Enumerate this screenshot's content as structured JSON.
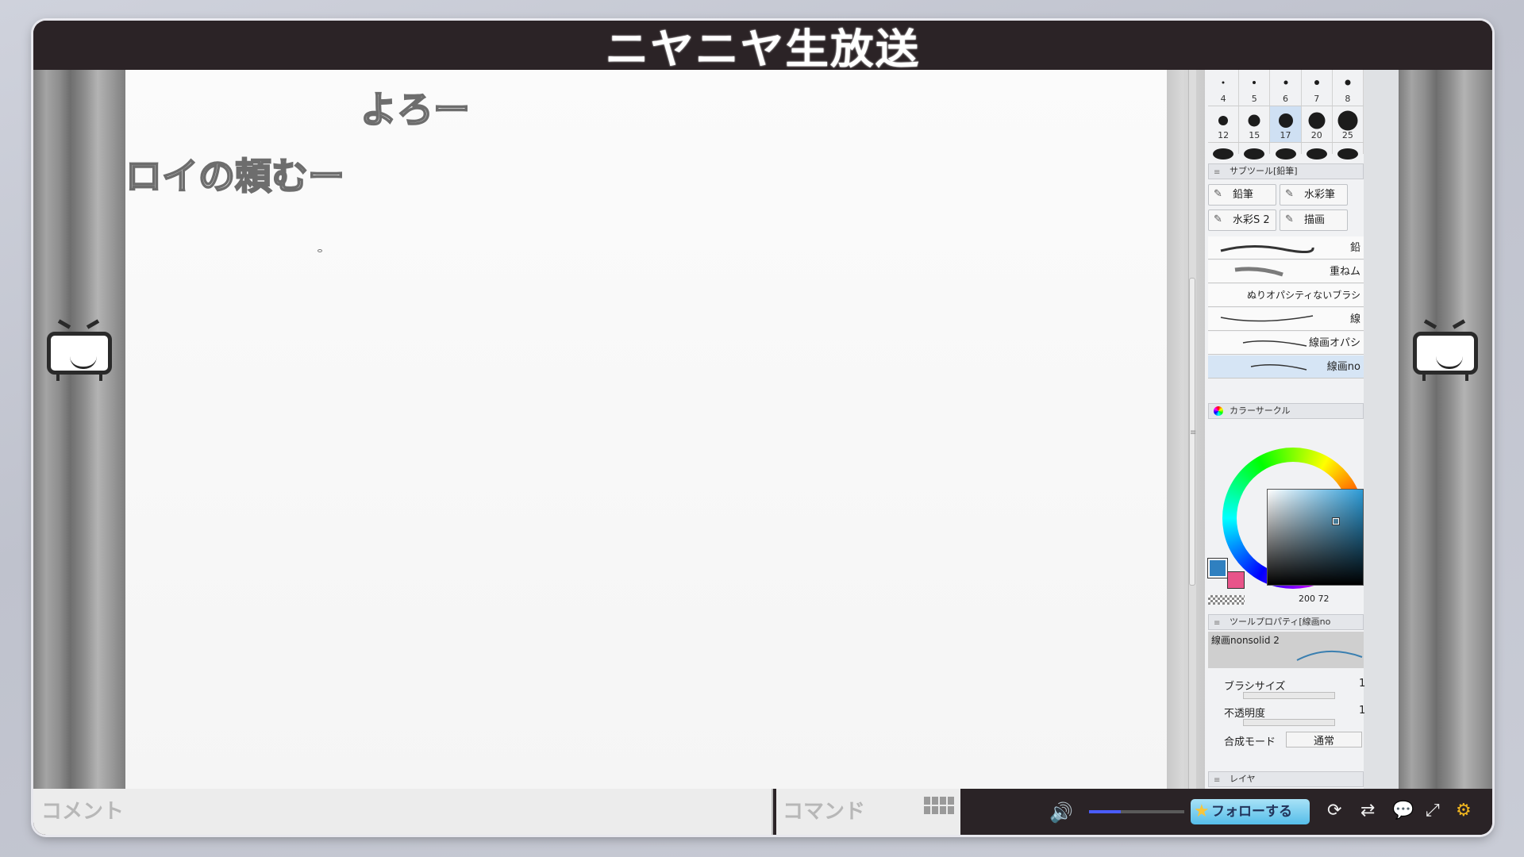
{
  "header": {
    "title": "ニヤニヤ生放送"
  },
  "comments": [
    "よろー",
    "ロイの頼むー"
  ],
  "brush_sizes": {
    "row1": [
      "4",
      "5",
      "6",
      "7",
      "8"
    ],
    "row2": [
      "12",
      "15",
      "17",
      "20",
      "25"
    ],
    "selected": "17"
  },
  "subtool_panel": {
    "title": "サブツール[鉛筆]",
    "tabs": [
      "鉛筆",
      "水彩筆",
      "水彩S 2",
      "描画"
    ],
    "brushes": [
      "鉛",
      "重ねム",
      "ぬりオパシティないブラシ",
      "線",
      "線画オパシ",
      "線画no"
    ],
    "selected_brush_index": 5
  },
  "color_panel": {
    "title": "カラーサークル",
    "main_color": "#2f80c0",
    "sub_color": "#e8548a",
    "readout_a": "200",
    "readout_b": "72"
  },
  "tool_property": {
    "title": "ツールプロパティ[線画no",
    "preset_name": "線画nonsolid 2",
    "brush_size_label": "ブラシサイズ",
    "brush_size_value": "1",
    "opacity_label": "不透明度",
    "opacity_value": "1",
    "blend_label": "合成モード",
    "blend_value": "通常"
  },
  "layer_panel": {
    "title": "レイヤ"
  },
  "bottom_bar": {
    "comment_placeholder": "コメント",
    "command_placeholder": "コマンド",
    "follow_label": "フォローする",
    "volume_level": 0.33
  },
  "icons": [
    "volume-icon",
    "refresh-icon",
    "repeat-icon",
    "comment-bubble-icon",
    "fullscreen-icon",
    "settings-gear-icon",
    "keyboard-icon",
    "star-icon",
    "niconico-tv-icon"
  ]
}
